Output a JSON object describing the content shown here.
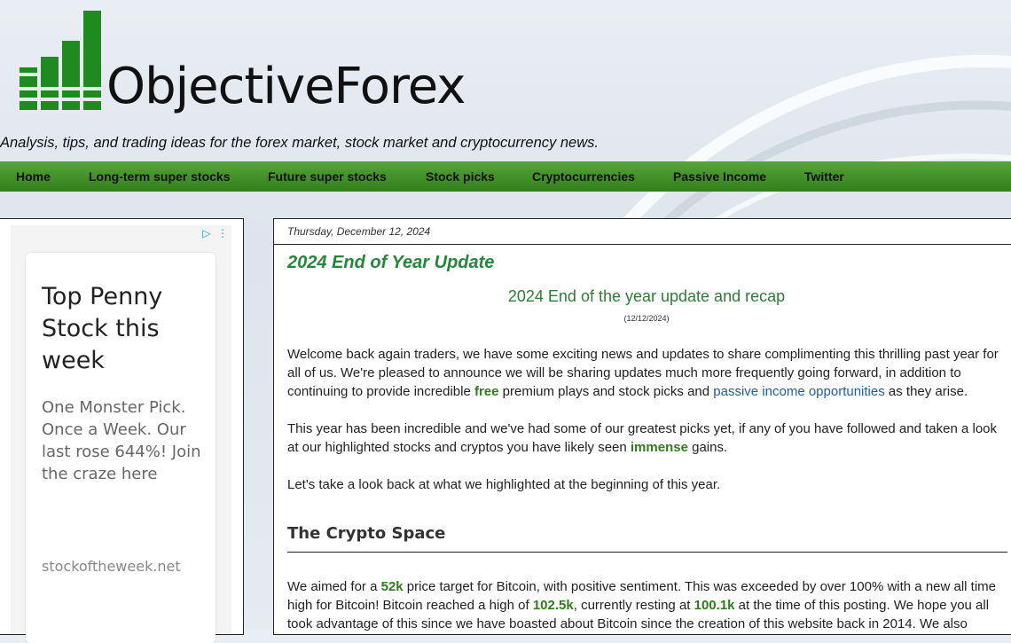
{
  "header": {
    "logo_text": "ObjectiveForex",
    "tagline": "Analysis, tips, and trading ideas for the forex market, stock market and cryptocurrency news."
  },
  "nav": {
    "items": [
      {
        "label": "Home"
      },
      {
        "label": "Long-term super stocks"
      },
      {
        "label": "Future super stocks"
      },
      {
        "label": "Stock picks"
      },
      {
        "label": "Cryptocurrencies"
      },
      {
        "label": "Passive Income"
      },
      {
        "label": "Twitter"
      }
    ]
  },
  "ad": {
    "title": "Top Penny Stock this week",
    "body": "One Monster Pick. Once a Week. Our last rose 644%! Join the craze here",
    "url": "stockoftheweek.net",
    "icons": [
      "adchoices-icon",
      "more-vertical-icon"
    ]
  },
  "post": {
    "date": "Thursday, December 12, 2024",
    "title": "2024 End of Year Update",
    "subtitle": "2024 End of the year update and recap",
    "subdate": "(12/12/2024)",
    "p1": {
      "a": "Welcome back again traders, we have some exciting news and updates to share complimenting this thrilling past year for all of us. We're pleased to announce we will be sharing updates much more frequently going forward, in addition to continuing to provide incredible ",
      "free": "free",
      "b": " premium plays and stock picks and ",
      "link": "passive income opportunities",
      "c": " as they arise."
    },
    "p2": {
      "a": "This year has been incredible and we've had some of our greatest picks yet, if any of you have followed and taken a look at our highlighted stocks and cryptos you have likely seen ",
      "immense": "immense",
      "b": " gains."
    },
    "p3": "Let's take a look back at what we highlighted at the beginning of this year.",
    "section_title": "The Crypto Space",
    "p4": {
      "a": "We aimed for a ",
      "v1": "52k",
      "b": " price target for Bitcoin, with positive sentiment. This was exceeded by over 100% with a new all time high for Bitcoin! Bitcoin reached a high of ",
      "v2": "102.5k",
      "c": ", currently resting at ",
      "v3": "100.1k",
      "d": " at the time of this posting. We hope you all took advantage of this since we have boasted about Bitcoin since the creation of this website back in 2014. We also"
    }
  },
  "colors": {
    "nav_green": "#3f8e26",
    "logo_green": "#1f8a1f",
    "title_green": "#23883a",
    "highlight_green": "#2e7d1a",
    "link_blue": "#1f5fa8"
  }
}
